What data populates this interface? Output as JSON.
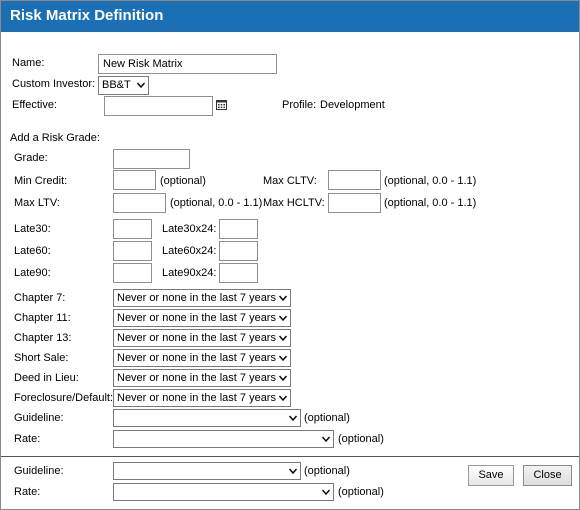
{
  "window": {
    "title": "Risk Matrix Definition"
  },
  "header_fields": {
    "name_label": "Name:",
    "name_value": "New Risk Matrix",
    "investor_label": "Custom Investor:",
    "investor_value": "BB&T",
    "effective_label": "Effective:",
    "effective_value": "",
    "profile_label": "Profile:",
    "profile_value": "Development"
  },
  "risk_grade": {
    "section_label": "Add a Risk Grade:",
    "grade_label": "Grade:",
    "min_credit_label": "Min Credit:",
    "min_credit_hint": "(optional)",
    "max_cltv_label": "Max CLTV:",
    "max_cltv_hint": "(optional, 0.0 - 1.1)",
    "max_ltv_label": "Max LTV:",
    "max_ltv_hint": "(optional, 0.0 - 1.1)",
    "max_hcltv_label": "Max HCLTV:",
    "max_hcltv_hint": "(optional, 0.0 - 1.1)",
    "late30_label": "Late30:",
    "late30x24_label": "Late30x24:",
    "late60_label": "Late60:",
    "late60x24_label": "Late60x24:",
    "late90_label": "Late90:",
    "late90x24_label": "Late90x24:",
    "events": [
      {
        "label": "Chapter 7:",
        "value": "Never or none in the last 7 years"
      },
      {
        "label": "Chapter 11:",
        "value": "Never or none in the last 7 years"
      },
      {
        "label": "Chapter 13:",
        "value": "Never or none in the last 7 years"
      },
      {
        "label": "Short Sale:",
        "value": "Never or none in the last 7 years"
      },
      {
        "label": "Deed in Lieu:",
        "value": "Never or none in the last 7 years"
      },
      {
        "label": "Foreclosure/Default:",
        "value": "Never or none in the last 7 years"
      }
    ],
    "guideline_label": "Guideline:",
    "guideline_value": "",
    "guideline_hint": "(optional)",
    "rate_label": "Rate:",
    "rate_value": "",
    "rate_hint": "(optional)"
  },
  "footer": {
    "guideline_label": "Guideline:",
    "guideline_value": "",
    "guideline_hint": "(optional)",
    "rate_label": "Rate:",
    "rate_value": "",
    "rate_hint": "(optional)",
    "save_label": "Save",
    "close_label": "Close"
  },
  "colors": {
    "titlebar": "#1a6fb5",
    "title_text": "#ffffff"
  },
  "icons": {
    "calendar": "calendar-icon",
    "dropdown": "chevron-down-icon"
  }
}
